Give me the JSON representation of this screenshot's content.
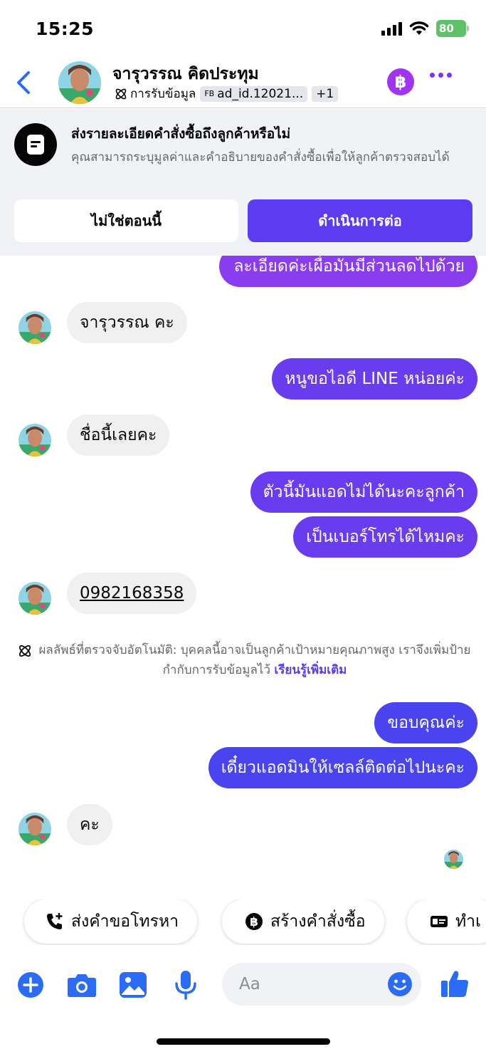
{
  "status_bar": {
    "time": "15:25",
    "battery": "80"
  },
  "header": {
    "contact_name": "จารุวรรณ คิดประทุม",
    "tag_label": "การรับข้อมูล",
    "ad_prefix": "FB",
    "ad_id": "ad_id.12021...",
    "more_tags": "+1",
    "accent_color": "#a034f0"
  },
  "banner": {
    "title": "ส่งรายละเอียดคำสั่งซื้อถึงลูกค้าหรือไม่",
    "description": "คุณสามารถระบุมูลค่าและคำอธิบายของคำสั่งซื้อเพื่อให้ลูกค้าตรวจสอบได้",
    "secondary_button": "ไม่ใช่ตอนนี้",
    "primary_button": "ดำเนินการต่อ"
  },
  "messages": [
    {
      "from": "me",
      "text": "ละเอียดค่ะเผื่อมันมีส่วนลดไปด้วย"
    },
    {
      "from": "contact",
      "text": "จารุวรรณ คะ"
    },
    {
      "from": "me",
      "text": "หนูขอไอดี LINE หน่อยค่ะ"
    },
    {
      "from": "contact",
      "text": "ชื่อนี้เลยคะ"
    },
    {
      "from": "me",
      "text": "ตัวนี้มันแอดไม่ได้นะคะลูกค้า"
    },
    {
      "from": "me",
      "text": "เป็นเบอร์โทรได้ไหมคะ"
    },
    {
      "from": "contact",
      "text": "0982168358"
    },
    {
      "from": "me",
      "text": "ขอบคุณค่ะ"
    },
    {
      "from": "me",
      "text": "เดี๋ยวแอดมินให้เซลล์ติดต่อไปนะคะ"
    },
    {
      "from": "contact",
      "text": "คะ"
    }
  ],
  "notice": {
    "text": "ผลลัพธ์ที่ตรวจจับอัตโนมัติ: บุคคลนี้อาจเป็นลูกค้าเป้าหมายคุณภาพสูง เราจึงเพิ่มป้ายกำกับการรับข้อมูลไว้",
    "link": "เรียนรู้เพิ่มเติม"
  },
  "quick_actions": [
    {
      "label": "ส่งคำขอโทรหา",
      "icon": "phone-plus-icon"
    },
    {
      "label": "สร้างคำสั่งซื้อ",
      "icon": "baht-icon"
    },
    {
      "label": "ทำเ",
      "icon": "id-card-icon"
    }
  ],
  "composer": {
    "placeholder": "Aa",
    "accent_color": "#2b6cf6"
  }
}
